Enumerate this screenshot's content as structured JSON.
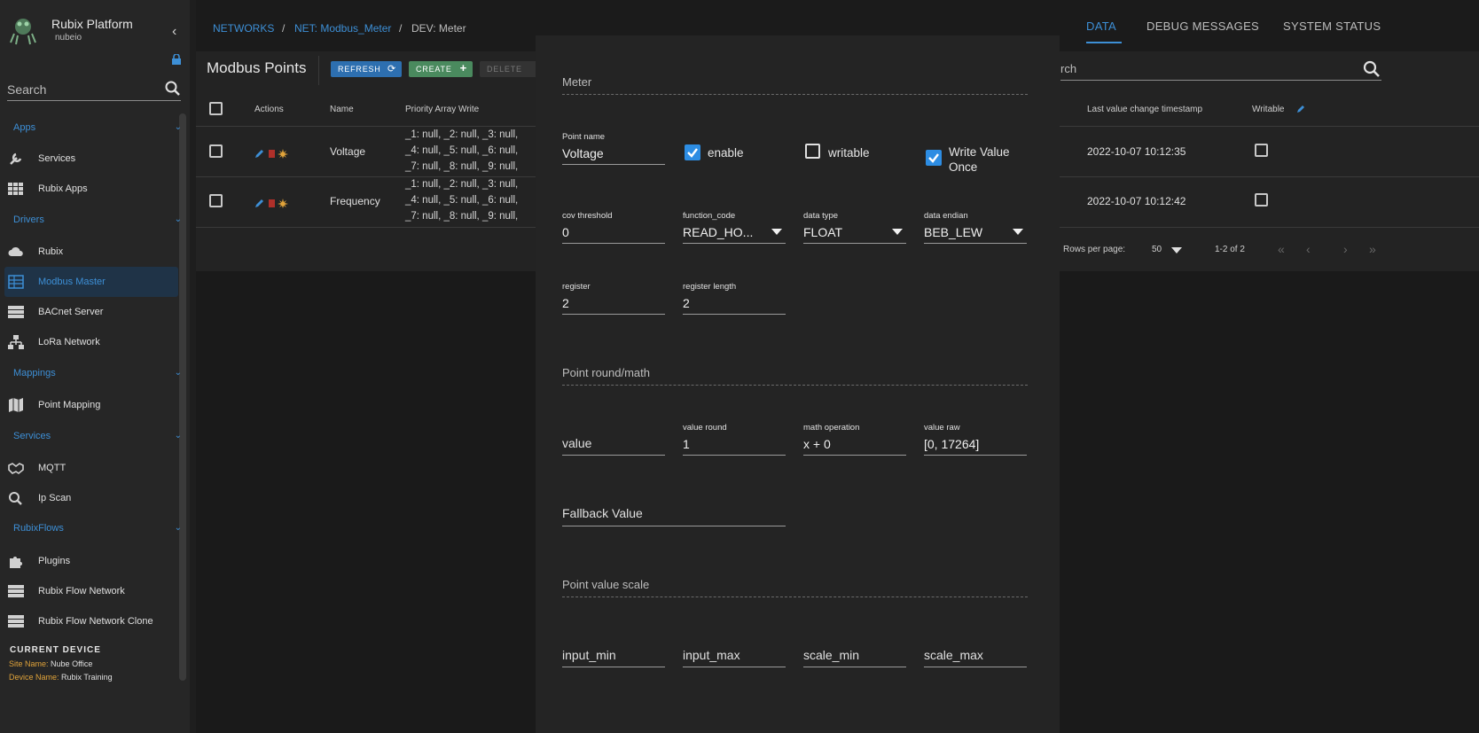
{
  "sidebar": {
    "title": "Rubix Platform",
    "subtitle": "nubeio",
    "search_placeholder": "Search",
    "sections": {
      "apps": "Apps",
      "drivers": "Drivers",
      "mappings": "Mappings",
      "services": "Services",
      "rubixflows": "RubixFlows"
    },
    "items": {
      "services": "Services",
      "rubix_apps": "Rubix Apps",
      "rubix": "Rubix",
      "modbus_master": "Modbus Master",
      "bacnet_server": "BACnet Server",
      "lora_network": "LoRa Network",
      "point_mapping": "Point Mapping",
      "mqtt": "MQTT",
      "ip_scan": "Ip Scan",
      "plugins": "Plugins",
      "rubix_flow_network": "Rubix Flow Network",
      "rubix_flow_network_clone": "Rubix Flow Network Clone"
    },
    "current_device": {
      "title": "CURRENT DEVICE",
      "site_key": "Site Name:",
      "site_value": "Nube Office",
      "device_key": "Device Name:",
      "device_value": "Rubix Training"
    }
  },
  "breadcrumb": {
    "networks": "NETWORKS",
    "sep1": "/",
    "net": "NET: Modbus_Meter",
    "sep2": "/",
    "dev": "DEV: Meter"
  },
  "tabs": {
    "data": "DATA",
    "debug": "DEBUG MESSAGES",
    "system": "SYSTEM STATUS"
  },
  "points": {
    "title": "Modbus Points",
    "refresh": "REFRESH",
    "create": "CREATE",
    "delete": "DELETE",
    "search_placeholder": "rch",
    "columns": {
      "actions": "Actions",
      "name": "Name",
      "priority": "Priority Array Write",
      "last_change": "Last value change timestamp",
      "writable": "Writable"
    },
    "rows": [
      {
        "name": "Voltage",
        "pa1": "_1: null,  _2: null,  _3: null,",
        "pa2": "_4: null,  _5: null,  _6: null,",
        "pa3": "_7: null,  _8: null,  _9: null,",
        "timestamp": "2022-10-07 10:12:35"
      },
      {
        "name": "Frequency",
        "pa1": "_1: null,  _2: null,  _3: null,",
        "pa2": "_4: null,  _5: null,  _6: null,",
        "pa3": "_7: null,  _8: null,  _9: null,",
        "timestamp": "2022-10-07 10:12:42"
      }
    ],
    "pagination": {
      "rows_per_page": "Rows per page:",
      "rows_value": "50",
      "range": "1-2 of 2"
    }
  },
  "modal": {
    "section_meter": "Meter",
    "point_name_label": "Point name",
    "point_name_value": "Voltage",
    "enable_label": "enable",
    "writable_label": "writable",
    "write_once_label_1": "Write Value",
    "write_once_label_2": "Once",
    "cov_label": "cov threshold",
    "cov_value": "0",
    "function_code_label": "function_code",
    "function_code_value": "READ_HO...",
    "data_type_label": "data type",
    "data_type_value": "FLOAT",
    "data_endian_label": "data endian",
    "data_endian_value": "BEB_LEW",
    "register_label": "register",
    "register_value": "2",
    "register_length_label": "register length",
    "register_length_value": "2",
    "section_round": "Point round/math",
    "value_placeholder": "value",
    "value_round_label": "value round",
    "value_round_value": "1",
    "math_label": "math operation",
    "math_value": "x + 0",
    "value_raw_label": "value raw",
    "value_raw_value": "[0, 17264]",
    "fallback_placeholder": "Fallback Value",
    "section_scale": "Point value scale",
    "input_min": "input_min",
    "input_max": "input_max",
    "scale_min": "scale_min",
    "scale_max": "scale_max"
  },
  "colors": {
    "accent": "#3d8fd6",
    "checkbox": "#2d8de3",
    "create_button": "#4a8a5e",
    "site_key": "#e0a33a"
  }
}
